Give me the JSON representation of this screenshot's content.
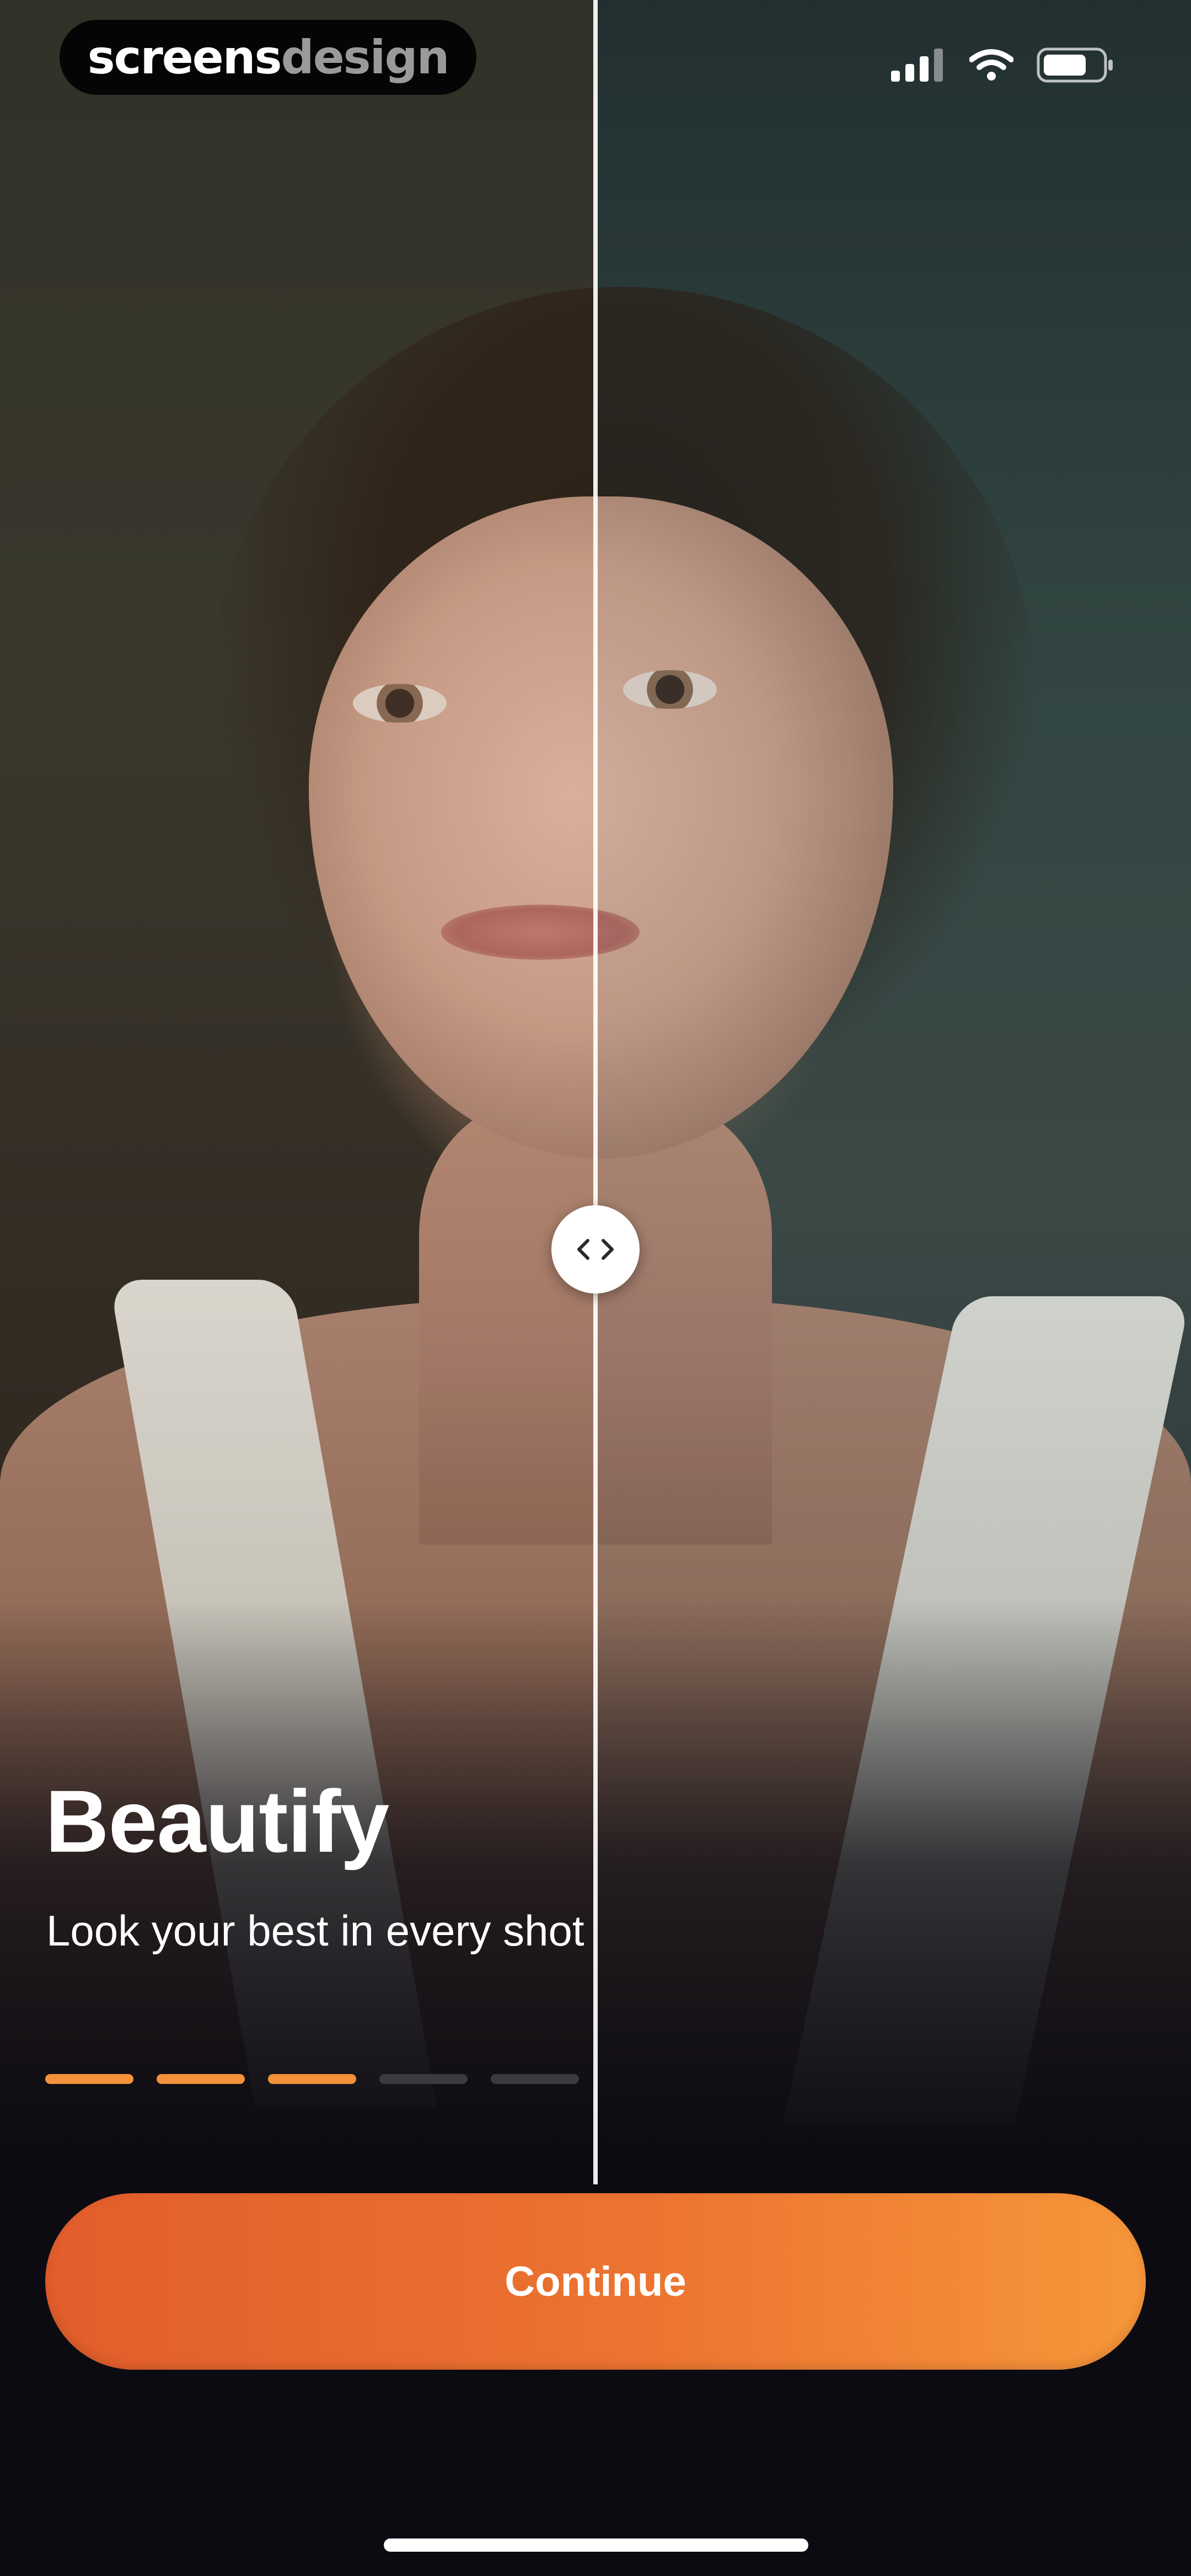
{
  "status_bar": {
    "brand_primary": "screens",
    "brand_secondary": "design",
    "icons": [
      "cellular-signal-icon",
      "wifi-icon",
      "battery-icon"
    ]
  },
  "comparison": {
    "handle_icon": "chevron-left-right-icon",
    "split_position": 0.5
  },
  "onboarding": {
    "title": "Beautify",
    "subtitle": "Look your best in every shot",
    "progress": {
      "total_steps": 5,
      "current_step": 3
    }
  },
  "actions": {
    "continue_label": "Continue"
  },
  "colors": {
    "accent": "#f3923a",
    "button_gradient_start": "#e25d2c",
    "button_gradient_end": "#f6963a",
    "background": "#0c0b12",
    "inactive_step": "#3a3a40"
  }
}
